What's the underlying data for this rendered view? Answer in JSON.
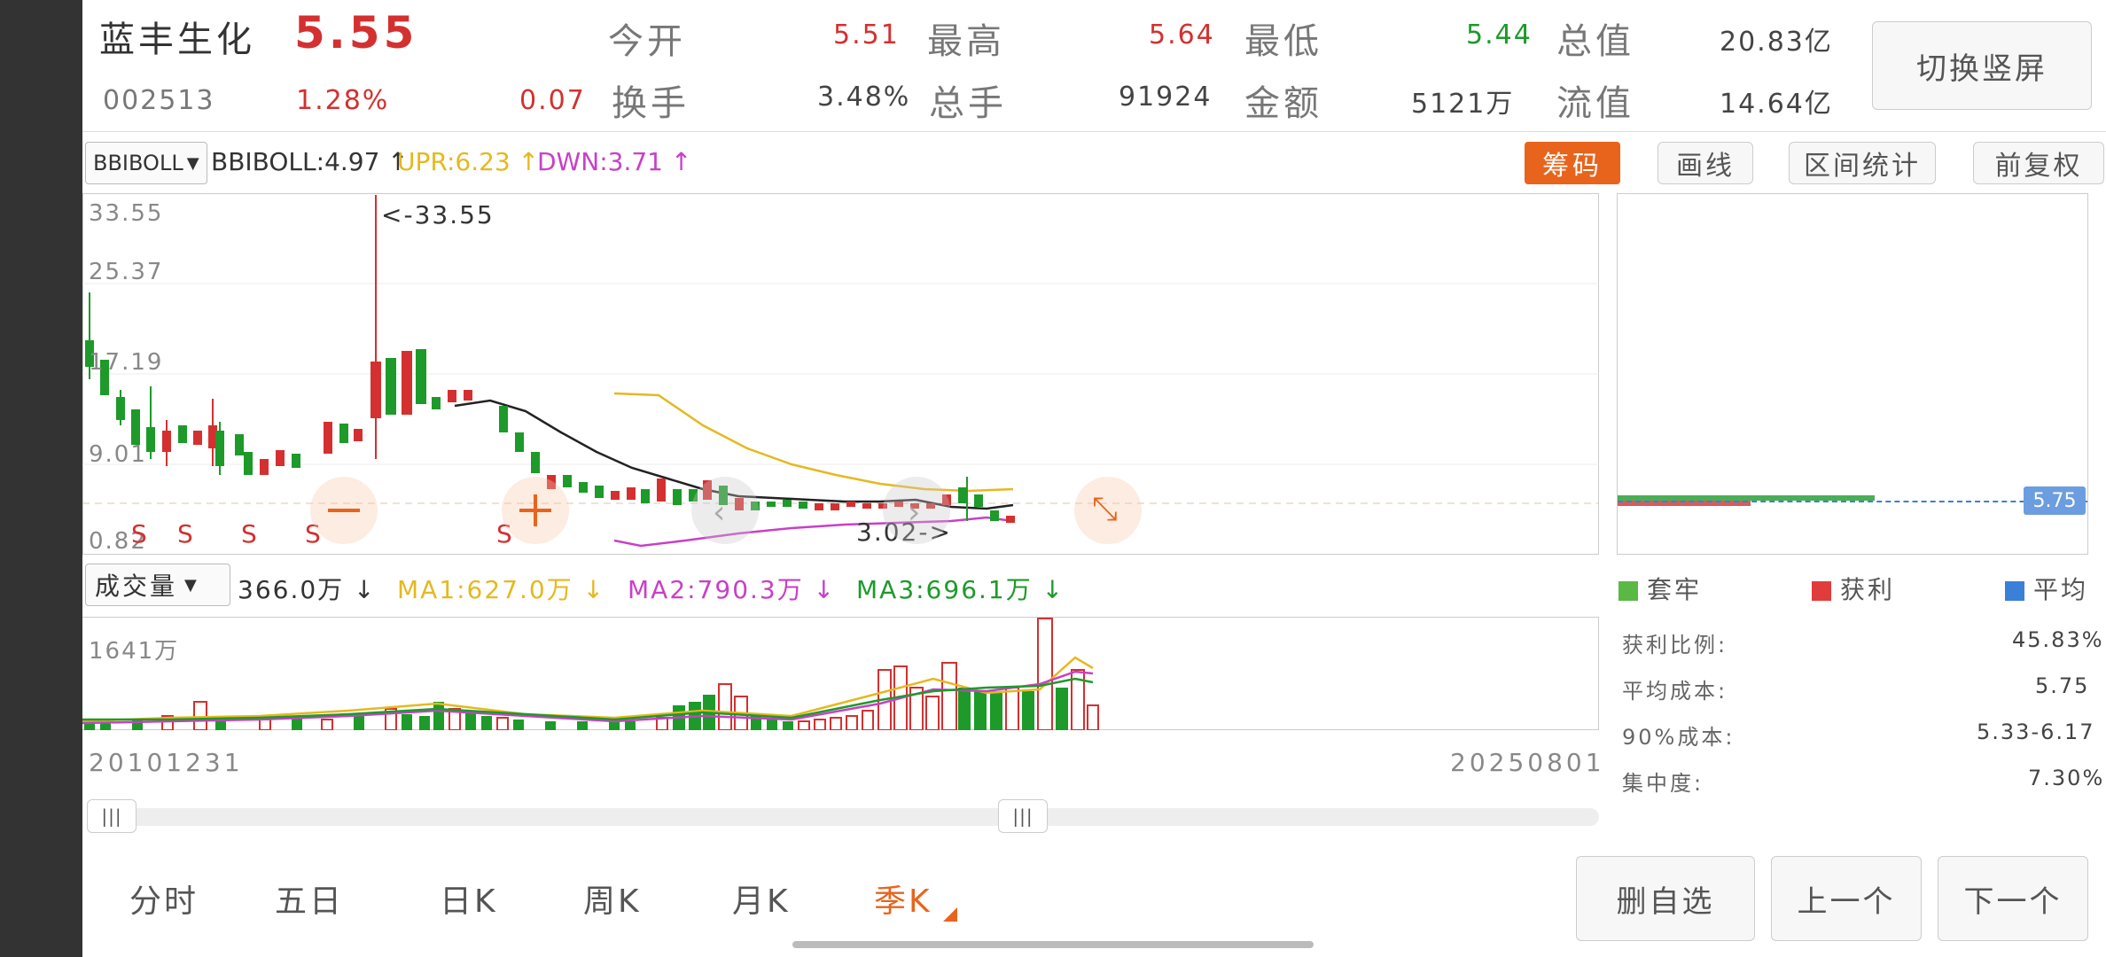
{
  "stock": {
    "name": "蓝丰生化",
    "price": "5.55",
    "code": "002513",
    "change_pct": "1.28%",
    "change": "0.07"
  },
  "quote": {
    "open_label": "今开",
    "open": "5.51",
    "high_label": "最高",
    "high": "5.64",
    "low_label": "最低",
    "low": "5.44",
    "total_cap_label": "总值",
    "total_cap": "20.83亿",
    "turnover_label": "换手",
    "turnover": "3.48%",
    "volume_label": "总手",
    "volume": "91924",
    "amount_label": "金额",
    "amount": "5121万",
    "float_cap_label": "流值",
    "float_cap": "14.64亿"
  },
  "switch_button": "切换竖屏",
  "indicator": {
    "select": "BBIBOLL",
    "bbiboll": "BBIBOLL:4.97 ↑",
    "upr": "UPR:6.23 ↑",
    "dwn": "DWN:3.71 ↑"
  },
  "toolbar": {
    "chips": "筹码",
    "draw": "画线",
    "range_stats": "区间统计",
    "adjust": "前复权"
  },
  "price_axis": [
    "33.55",
    "25.37",
    "17.19",
    "9.01",
    "0.82"
  ],
  "annotations": {
    "max": "<-33.55",
    "min": "3.02->",
    "signals": [
      "S",
      "S",
      "S",
      "S",
      "S"
    ]
  },
  "volume_indicator": {
    "select": "成交量",
    "vol": "366.0万 ↓",
    "ma1": "MA1:627.0万 ↓",
    "ma2": "MA2:790.3万 ↓",
    "ma3": "MA3:696.1万 ↓",
    "axis_max": "1641万"
  },
  "date_axis": {
    "start": "20101231",
    "end": "20250801"
  },
  "chips_panel": {
    "avg_marker": "5.75",
    "legend": {
      "trapped": "套牢",
      "profit": "获利",
      "average": "平均"
    },
    "profit_ratio_label": "获利比例:",
    "profit_ratio": "45.83%",
    "avg_cost_label": "平均成本:",
    "avg_cost": "5.75",
    "cost90_label": "90%成本:",
    "cost90": "5.33-6.17",
    "concentration_label": "集中度:",
    "concentration": "7.30%"
  },
  "period_tabs": [
    "分时",
    "五日",
    "日K",
    "周K",
    "月K",
    "季K"
  ],
  "actions": {
    "remove": "删自选",
    "prev": "上一个",
    "next": "下一个"
  },
  "colors": {
    "up": "#d43030",
    "down": "#1d9a2a",
    "accent": "#e8641c",
    "ma1": "#e6b820",
    "ma2": "#c840c8",
    "ma3": "#1d9a2a",
    "avg": "#3a7fd8"
  }
}
